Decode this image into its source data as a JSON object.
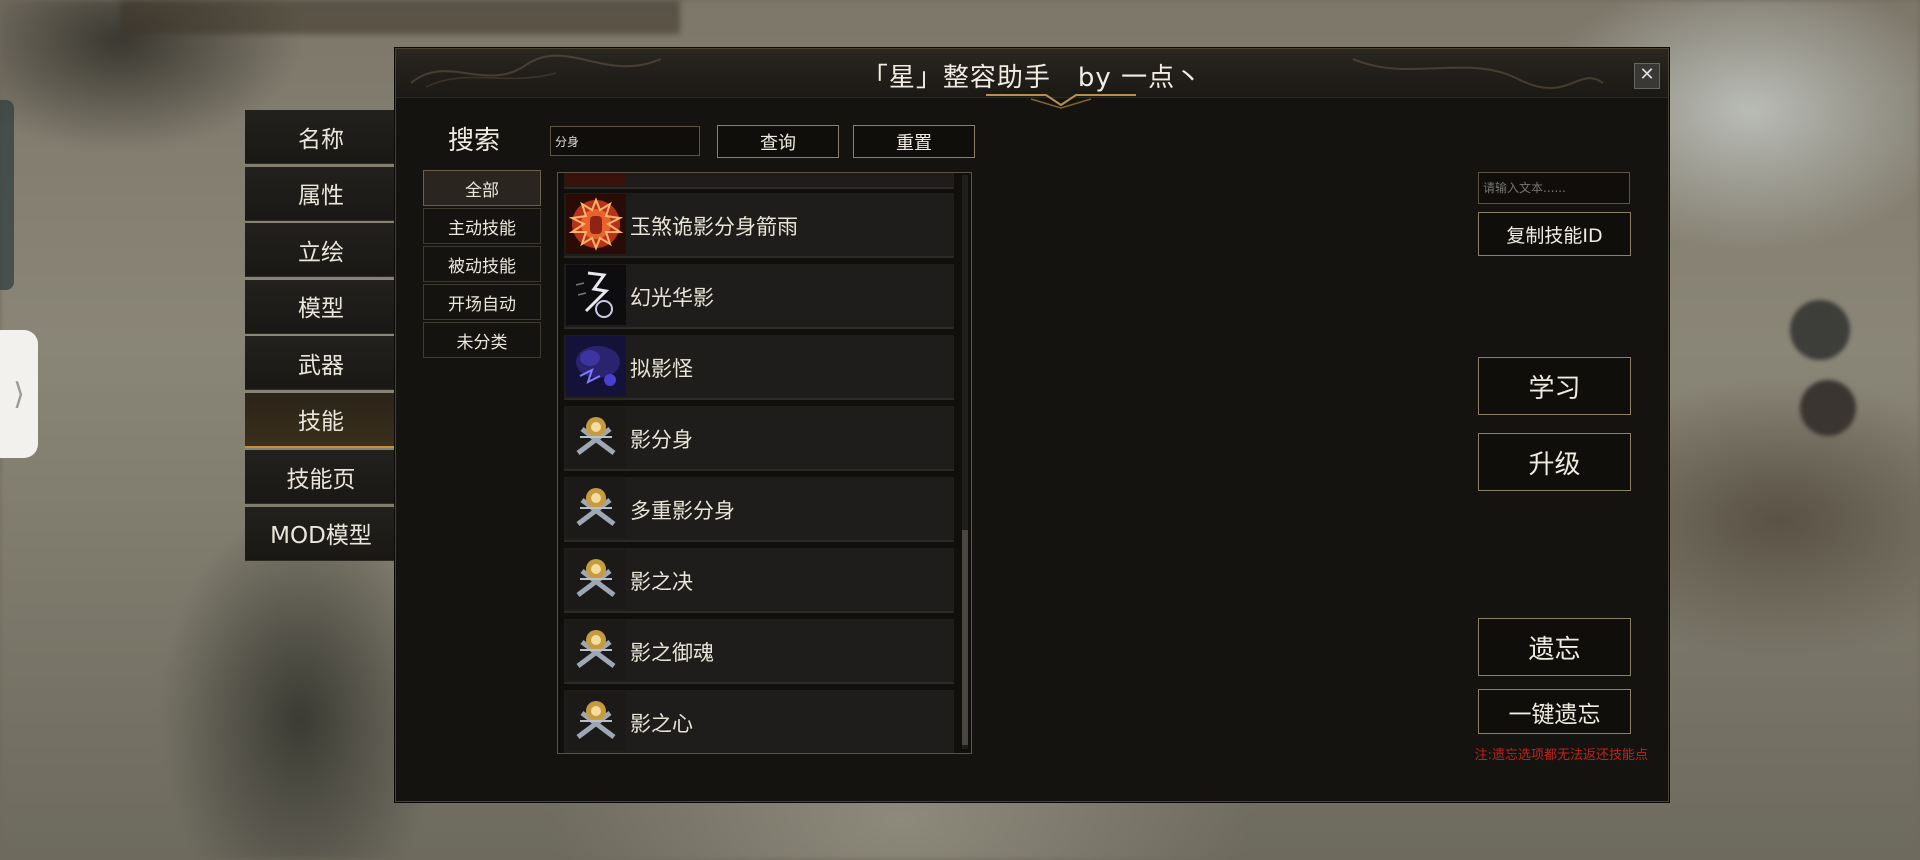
{
  "window": {
    "title": "「星」整容助手　by 一点丶",
    "close_label": "✕"
  },
  "side_handle_label": "⟩",
  "category_nav": [
    {
      "label": "名称",
      "active": false
    },
    {
      "label": "属性",
      "active": false
    },
    {
      "label": "立绘",
      "active": false
    },
    {
      "label": "模型",
      "active": false
    },
    {
      "label": "武器",
      "active": false
    },
    {
      "label": "技能",
      "active": true
    },
    {
      "label": "技能页",
      "active": false
    },
    {
      "label": "MOD模型",
      "active": false
    }
  ],
  "search": {
    "label": "搜索",
    "input_value": "分身",
    "query_button": "查询",
    "reset_button": "重置"
  },
  "filters": [
    {
      "label": "全部",
      "active": true
    },
    {
      "label": "主动技能",
      "active": false
    },
    {
      "label": "被动技能",
      "active": false
    },
    {
      "label": "开场自动",
      "active": false
    },
    {
      "label": "未分类",
      "active": false
    }
  ],
  "skills": [
    {
      "name": "",
      "icon": "red-flame-icon"
    },
    {
      "name": "玉煞诡影分身箭雨",
      "icon": "red-flame-icon"
    },
    {
      "name": "幻光华影",
      "icon": "lightning-icon"
    },
    {
      "name": "拟影怪",
      "icon": "purple-shadow-icon"
    },
    {
      "name": "影分身",
      "icon": "crossed-swords-emblem-icon"
    },
    {
      "name": "多重影分身",
      "icon": "crossed-swords-emblem-icon"
    },
    {
      "name": "影之决",
      "icon": "crossed-swords-emblem-icon"
    },
    {
      "name": "影之御魂",
      "icon": "crossed-swords-emblem-icon"
    },
    {
      "name": "影之心",
      "icon": "crossed-swords-emblem-icon"
    }
  ],
  "right_panel": {
    "text_input_placeholder": "请输入文本......",
    "copy_id_button": "复制技能ID",
    "learn_button": "学习",
    "upgrade_button": "升级",
    "forget_button": "遗忘",
    "forget_all_button": "一键遗忘",
    "note": "注:遗忘选项都无法返还技能点"
  },
  "colors": {
    "accent": "#c98d3c",
    "note": "#c0231f",
    "window_bg": "#15130f"
  }
}
